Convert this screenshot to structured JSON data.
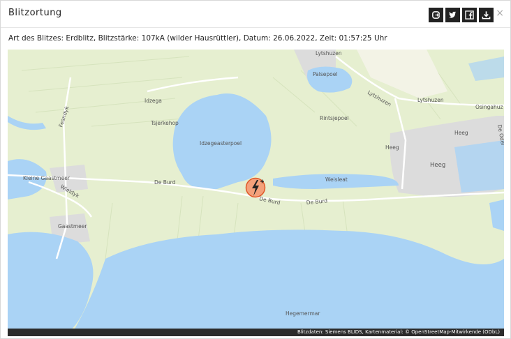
{
  "modal": {
    "title": "Blitzortung",
    "info": "Art des Blitzes: Erdblitz, Blitzstärke: 107kA (wilder Hausrüttler), Datum: 26.06.2022, Zeit: 01:57:25 Uhr",
    "close_symbol": "×"
  },
  "toolbar": [
    {
      "icon": "share-icon"
    },
    {
      "icon": "twitter-icon"
    },
    {
      "icon": "facebook-icon"
    },
    {
      "icon": "download-icon"
    }
  ],
  "map": {
    "places": {
      "lytshuzen_top": "Lytshuzen",
      "palsepoel": "Palsepoel",
      "lytshuzen_road": "Lytshuzen",
      "lytshuzen_right": "Lytshuzen",
      "osingahuzen": "Osingahuz",
      "idzega": "Idzega",
      "tsjerkehop": "Tsjerkehop",
      "idzegeasterpoel": "Idzegeasterpoel",
      "rintsjepoel": "Rintsjepoel",
      "heeg_small": "Heeg",
      "heeg_east": "Heeg",
      "heeg_main": "Heeg",
      "de_ode": "De Odel",
      "kleine_gaastmeer": "Kleine Gaastmeer",
      "wieldyk": "Wieldyk",
      "feandyk": "Feandyk",
      "de_burd_left": "De Burd",
      "de_burd_mid": "De Burd",
      "de_burd_right": "De Burd",
      "weisleat": "Weisleat",
      "gaastmeer": "Gaastmeer",
      "hegemermar": "Hegemermar"
    },
    "attribution": "Blitzdaten: Siemens BLIDS, Kartenmaterial: © OpenStreetMap-Mitwirkende (ODbL)",
    "colors": {
      "land": "#e6efd0",
      "water": "#aad3f5",
      "urban": "#dcdcdc",
      "road": "#ffffff",
      "marker": "#f4a07a"
    }
  }
}
